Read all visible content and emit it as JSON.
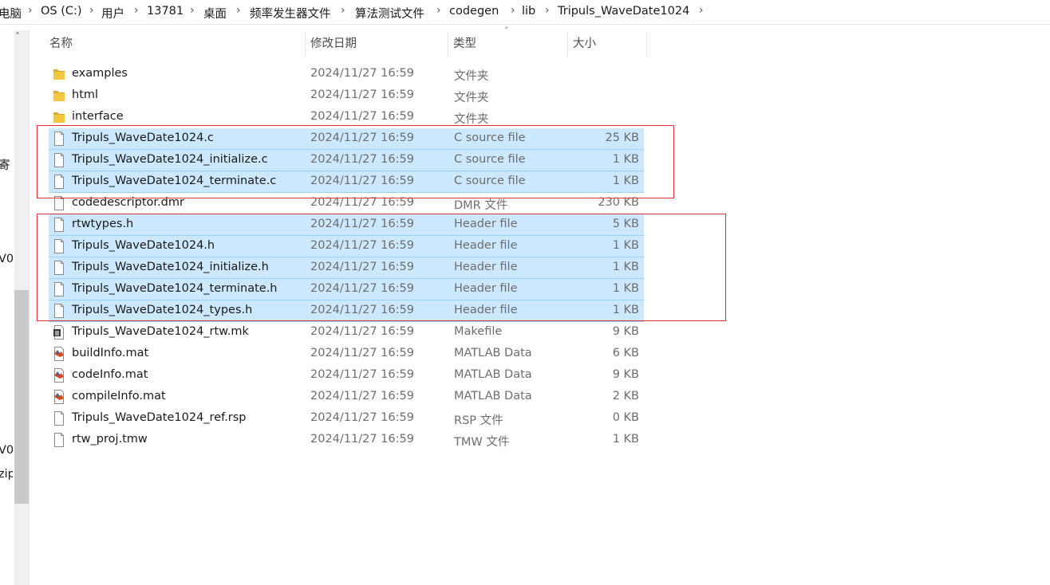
{
  "breadcrumb": [
    "电脑",
    "OS (C:)",
    "用户",
    "13781",
    "桌面",
    "频率发生器文件",
    "算法测试文件",
    "codegen",
    "lib",
    "Tripuls_WaveDate1024"
  ],
  "nav_fragments": [
    "寄",
    "V0.",
    "V0.",
    "zip"
  ],
  "columns": {
    "name": "名称",
    "date": "修改日期",
    "type": "类型",
    "size": "大小"
  },
  "colors": {
    "selection": "#cce8ff",
    "selection_border": "#99d1ff",
    "annotation": "#e0303a",
    "folder": "#f3c640"
  },
  "files": [
    {
      "name": "examples",
      "date": "2024/11/27 16:59",
      "type": "文件夹",
      "size": "",
      "icon": "folder-icon",
      "selected": false
    },
    {
      "name": "html",
      "date": "2024/11/27 16:59",
      "type": "文件夹",
      "size": "",
      "icon": "folder-icon",
      "selected": false
    },
    {
      "name": "interface",
      "date": "2024/11/27 16:59",
      "type": "文件夹",
      "size": "",
      "icon": "folder-icon",
      "selected": false
    },
    {
      "name": "Tripuls_WaveDate1024.c",
      "date": "2024/11/27 16:59",
      "type": "C source file",
      "size": "25 KB",
      "icon": "file-icon",
      "selected": true
    },
    {
      "name": "Tripuls_WaveDate1024_initialize.c",
      "date": "2024/11/27 16:59",
      "type": "C source file",
      "size": "1 KB",
      "icon": "file-icon",
      "selected": true
    },
    {
      "name": "Tripuls_WaveDate1024_terminate.c",
      "date": "2024/11/27 16:59",
      "type": "C source file",
      "size": "1 KB",
      "icon": "file-icon",
      "selected": true
    },
    {
      "name": "codedescriptor.dmr",
      "date": "2024/11/27 16:59",
      "type": "DMR 文件",
      "size": "230 KB",
      "icon": "file-icon",
      "selected": false
    },
    {
      "name": "rtwtypes.h",
      "date": "2024/11/27 16:59",
      "type": "Header file",
      "size": "5 KB",
      "icon": "file-icon",
      "selected": true
    },
    {
      "name": "Tripuls_WaveDate1024.h",
      "date": "2024/11/27 16:59",
      "type": "Header file",
      "size": "1 KB",
      "icon": "file-icon",
      "selected": true
    },
    {
      "name": "Tripuls_WaveDate1024_initialize.h",
      "date": "2024/11/27 16:59",
      "type": "Header file",
      "size": "1 KB",
      "icon": "file-icon",
      "selected": true
    },
    {
      "name": "Tripuls_WaveDate1024_terminate.h",
      "date": "2024/11/27 16:59",
      "type": "Header file",
      "size": "1 KB",
      "icon": "file-icon",
      "selected": true
    },
    {
      "name": "Tripuls_WaveDate1024_types.h",
      "date": "2024/11/27 16:59",
      "type": "Header file",
      "size": "1 KB",
      "icon": "file-icon",
      "selected": true
    },
    {
      "name": "Tripuls_WaveDate1024_rtw.mk",
      "date": "2024/11/27 16:59",
      "type": "Makefile",
      "size": "9 KB",
      "icon": "makefile-icon",
      "selected": false
    },
    {
      "name": "buildInfo.mat",
      "date": "2024/11/27 16:59",
      "type": "MATLAB Data",
      "size": "6 KB",
      "icon": "matlab-data-icon",
      "selected": false
    },
    {
      "name": "codeInfo.mat",
      "date": "2024/11/27 16:59",
      "type": "MATLAB Data",
      "size": "9 KB",
      "icon": "matlab-data-icon",
      "selected": false
    },
    {
      "name": "compileInfo.mat",
      "date": "2024/11/27 16:59",
      "type": "MATLAB Data",
      "size": "2 KB",
      "icon": "matlab-data-icon",
      "selected": false
    },
    {
      "name": "Tripuls_WaveDate1024_ref.rsp",
      "date": "2024/11/27 16:59",
      "type": "RSP 文件",
      "size": "0 KB",
      "icon": "file-icon",
      "selected": false
    },
    {
      "name": "rtw_proj.tmw",
      "date": "2024/11/27 16:59",
      "type": "TMW 文件",
      "size": "1 KB",
      "icon": "file-icon",
      "selected": false
    }
  ]
}
